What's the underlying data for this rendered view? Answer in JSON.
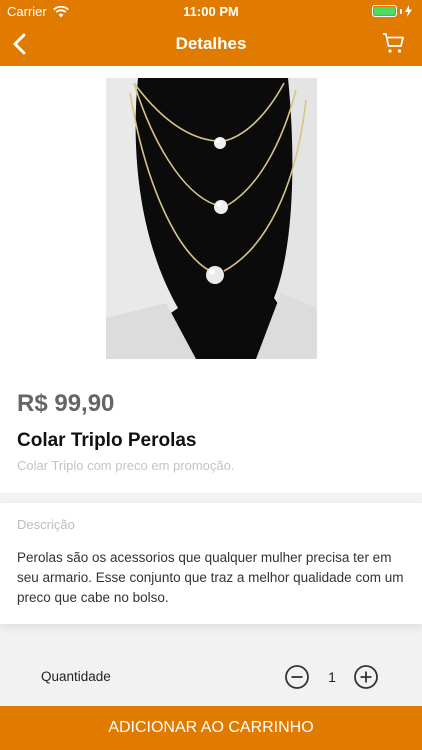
{
  "status_bar": {
    "carrier": "Carrier",
    "time": "11:00 PM"
  },
  "nav": {
    "title": "Detalhes"
  },
  "product": {
    "price": "R$ 99,90",
    "name": "Colar Triplo Perolas",
    "subtitle": "Colar Triplo com preco em promoção."
  },
  "description": {
    "label": "Descrição",
    "text": "Perolas são os acessorios que qualquer mulher precisa ter em seu armario. Esse conjunto que traz a melhor qualidade com um preco que cabe no bolso."
  },
  "quantity": {
    "label": "Quantidade",
    "value": "1"
  },
  "button": {
    "add_to_cart": "ADICIONAR AO CARRINHO"
  },
  "colors": {
    "accent": "#e07b00"
  }
}
